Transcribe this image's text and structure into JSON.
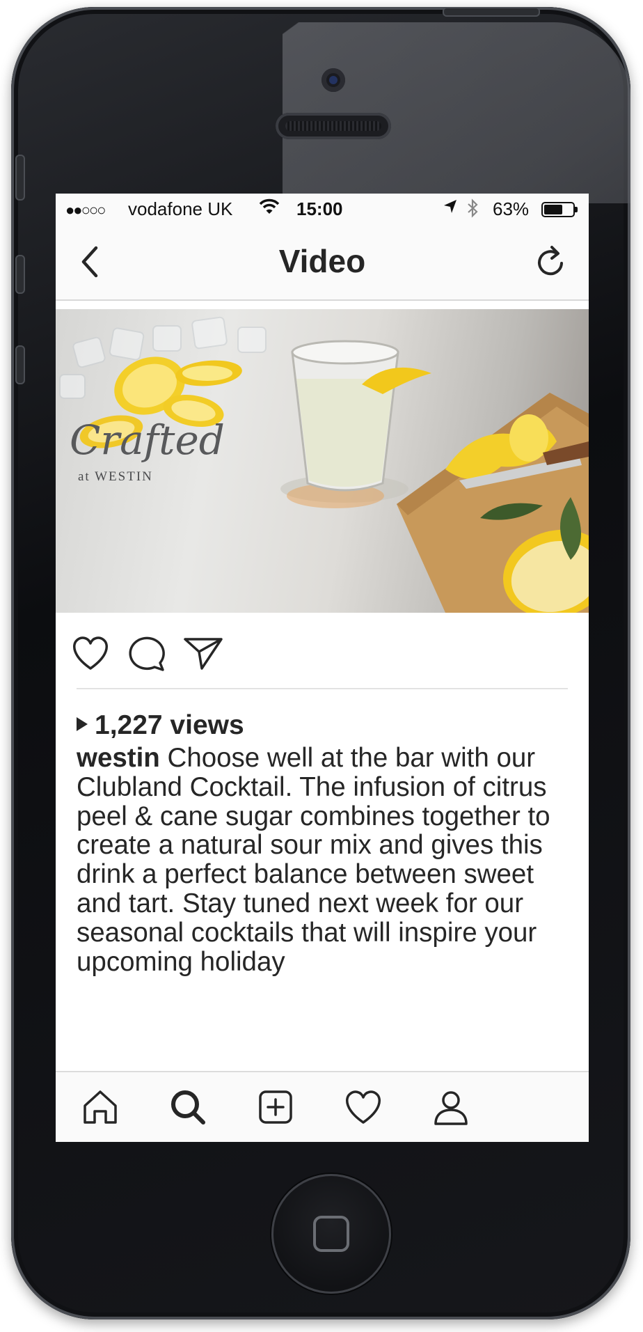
{
  "status_bar": {
    "signal": "●●○○○",
    "carrier": "vodafone UK",
    "time": "15:00",
    "battery": "63%"
  },
  "header": {
    "title": "Video"
  },
  "video": {
    "brand_script": "Crafted",
    "brand_sub": "at WESTIN"
  },
  "post": {
    "views": "1,227 views",
    "username": "westin",
    "caption": "Choose well at the bar with our Clubland Cocktail. The infusion of citrus peel & cane sugar combines together to create a natural sour mix and gives this drink a perfect balance between sweet and tart. Stay tuned next week for our seasonal cocktails that will inspire your upcoming holiday"
  },
  "icons": {
    "back": "chevron-left-icon",
    "refresh": "refresh-icon",
    "like": "heart-icon",
    "comment": "comment-icon",
    "share": "send-icon",
    "tabs": [
      "home-icon",
      "search-icon",
      "add-post-icon",
      "activity-heart-icon",
      "profile-icon"
    ]
  },
  "colors": {
    "text": "#262626",
    "bar_background": "#fafafa",
    "divider": "#dcdcdc"
  }
}
